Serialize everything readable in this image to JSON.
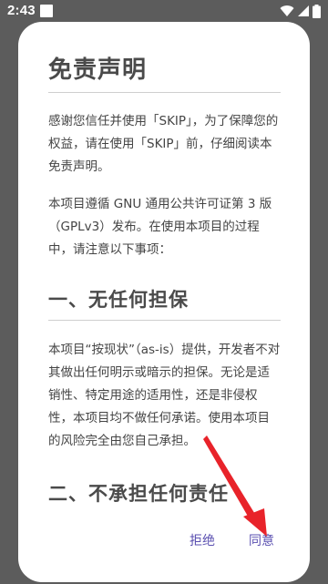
{
  "status_bar": {
    "time": "2:43"
  },
  "dialog": {
    "title": "免责声明",
    "paragraph1": "感谢您信任并使用「SKIP」，为了保障您的权益，请在使用「SKIP」前，仔细阅读本免责声明。",
    "paragraph2": "本项目遵循 GNU 通用公共许可证第 3 版（GPLv3）发布。在使用本项目的过程中，请注意以下事项：",
    "section1_title": "一、无任何担保",
    "section1_body": "本项目“按现状”（as-is）提供，开发者不对其做出任何明示或暗示的担保。无论是适销性、特定用途的适用性，还是非侵权性，本项目均不做任何承诺。使用本项目的风险完全由您自己承担。",
    "section2_title": "二、不承担任何责任",
    "reject_label": "拒绝",
    "agree_label": "同意"
  },
  "colors": {
    "accent": "#5a4fb0",
    "annotation_arrow": "#e8232a"
  },
  "icons": [
    "status-square-icon",
    "wifi-icon",
    "signal-icon",
    "battery-icon"
  ]
}
